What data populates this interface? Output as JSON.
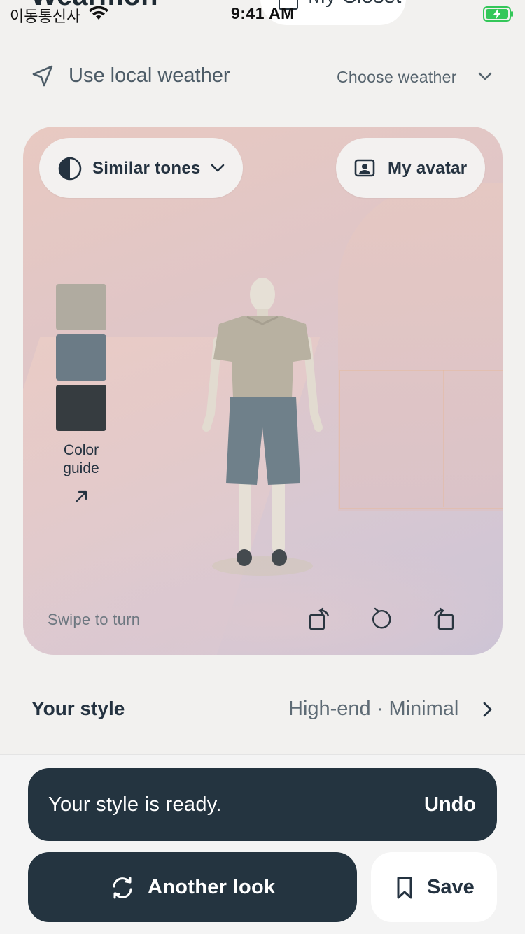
{
  "status_bar": {
    "carrier": "이동통신사",
    "time": "9:41 AM",
    "wifi_icon": "wifi-icon",
    "battery_icon": "battery-charging-icon",
    "battery_color": "#34c759"
  },
  "header": {
    "brand_peek": "Wearmon",
    "closet_label": "My Closet"
  },
  "weather": {
    "local_label": "Use local weather",
    "local_icon": "location-arrow-icon",
    "choose_label": "Choose weather",
    "choose_icon": "chevron-down-icon"
  },
  "stage": {
    "tones_label": "Similar tones",
    "tones_icon": "half-circle-contrast-icon",
    "avatar_label": "My avatar",
    "avatar_icon": "portrait-icon",
    "color_guide": {
      "label_line1": "Color",
      "label_line2": "guide",
      "icon": "arrow-up-right-icon",
      "swatches": [
        "#b0aba0",
        "#6b7b86",
        "#363c40"
      ]
    },
    "swipe_hint": "Swipe to turn",
    "controls": [
      "rotate-left-icon",
      "reset-rotation-icon",
      "rotate-right-icon"
    ]
  },
  "style": {
    "title": "Your style",
    "value": "High-end · Minimal",
    "icon": "chevron-right-icon"
  },
  "toast": {
    "message": "Your style is ready.",
    "action": "Undo"
  },
  "actions": {
    "another_label": "Another look",
    "another_icon": "refresh-icon",
    "save_label": "Save",
    "save_icon": "bookmark-icon"
  },
  "colors": {
    "accent_dark": "#243440",
    "background": "#f2f1ef"
  }
}
